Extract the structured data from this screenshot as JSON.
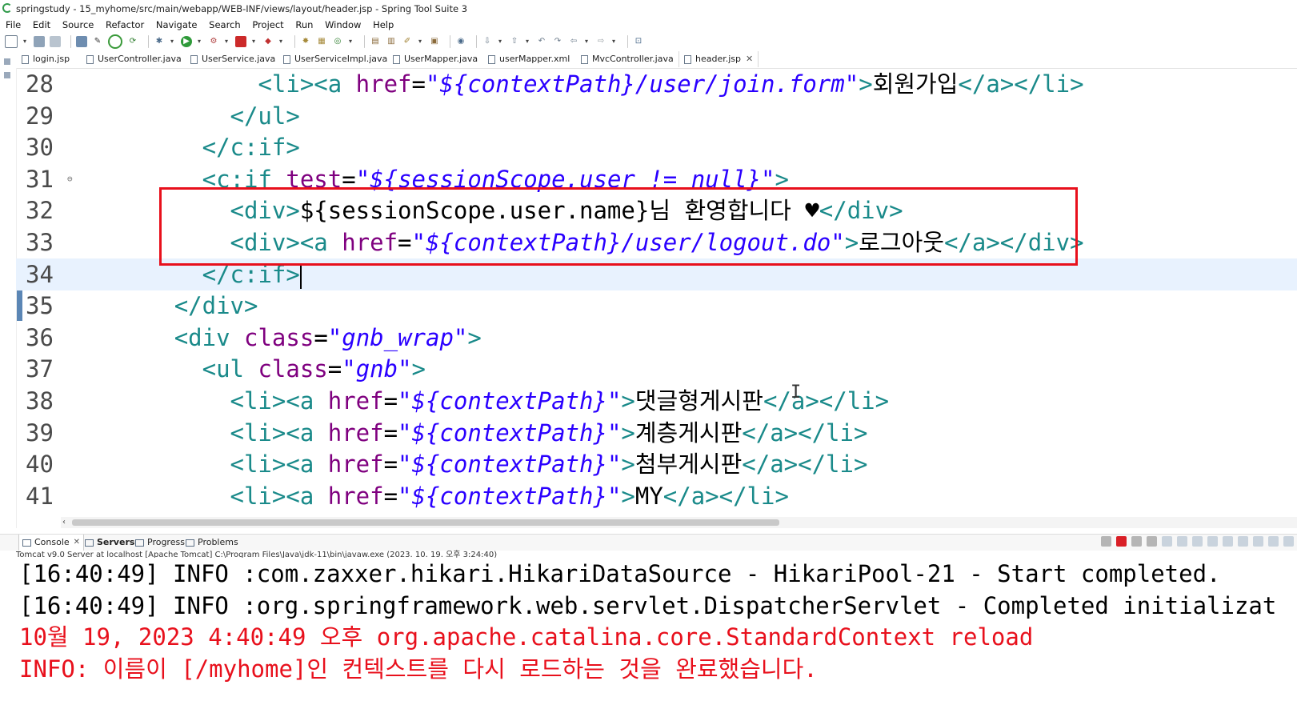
{
  "window": {
    "title": "springstudy - 15_myhome/src/main/webapp/WEB-INF/views/layout/header.jsp - Spring Tool Suite 3"
  },
  "menu": [
    "File",
    "Edit",
    "Source",
    "Refactor",
    "Navigate",
    "Search",
    "Project",
    "Run",
    "Window",
    "Help"
  ],
  "tabs": [
    {
      "label": "login.jsp"
    },
    {
      "label": "UserController.java"
    },
    {
      "label": "UserService.java"
    },
    {
      "label": "UserServiceImpl.java"
    },
    {
      "label": "UserMapper.java"
    },
    {
      "label": "userMapper.xml"
    },
    {
      "label": "MvcController.java"
    },
    {
      "label": "header.jsp",
      "active": true
    }
  ],
  "editor": {
    "current_line": "34",
    "lines": [
      {
        "n": "28",
        "indent": "      ",
        "tokens": [
          [
            "tag",
            "<li><a "
          ],
          [
            "attr",
            "href"
          ],
          [
            "txt",
            "="
          ],
          [
            "str",
            "\"${contextPath}/user/join.form\""
          ],
          [
            "tag",
            ">"
          ],
          [
            "txt",
            "회원가입"
          ],
          [
            "tag",
            "</a></li>"
          ]
        ]
      },
      {
        "n": "29",
        "indent": "     ",
        "tokens": [
          [
            "tag",
            "</ul>"
          ]
        ]
      },
      {
        "n": "30",
        "indent": "    ",
        "tokens": [
          [
            "tag",
            "</c:if>"
          ]
        ]
      },
      {
        "n": "31",
        "indent": "    ",
        "fold": "⊖",
        "tokens": [
          [
            "tag",
            "<c:if "
          ],
          [
            "attr",
            "test"
          ],
          [
            "txt",
            "="
          ],
          [
            "str",
            "\"${sessionScope.user != null}\""
          ],
          [
            "tag",
            ">"
          ]
        ]
      },
      {
        "n": "32",
        "indent": "     ",
        "tokens": [
          [
            "tag",
            "<div>"
          ],
          [
            "txt",
            "${sessionScope.user.name}님 환영합니다 ♥"
          ],
          [
            "tag",
            "</div>"
          ]
        ]
      },
      {
        "n": "33",
        "indent": "     ",
        "tokens": [
          [
            "tag",
            "<div><a "
          ],
          [
            "attr",
            "href"
          ],
          [
            "txt",
            "="
          ],
          [
            "str",
            "\"${contextPath}/user/logout.do\""
          ],
          [
            "tag",
            ">"
          ],
          [
            "txt",
            "로그아웃"
          ],
          [
            "tag",
            "</a></div>"
          ]
        ]
      },
      {
        "n": "34",
        "indent": "    ",
        "tokens": [
          [
            "tag",
            "</c:if>"
          ]
        ]
      },
      {
        "n": "35",
        "indent": "   ",
        "tokens": [
          [
            "tag",
            "</div>"
          ]
        ]
      },
      {
        "n": "36",
        "indent": "   ",
        "tokens": [
          [
            "tag",
            "<div "
          ],
          [
            "attr",
            "class"
          ],
          [
            "txt",
            "="
          ],
          [
            "str",
            "\"gnb_wrap\""
          ],
          [
            "tag",
            ">"
          ]
        ]
      },
      {
        "n": "37",
        "indent": "    ",
        "tokens": [
          [
            "tag",
            "<ul "
          ],
          [
            "attr",
            "class"
          ],
          [
            "txt",
            "="
          ],
          [
            "str",
            "\"gnb\""
          ],
          [
            "tag",
            ">"
          ]
        ]
      },
      {
        "n": "38",
        "indent": "     ",
        "tokens": [
          [
            "tag",
            "<li><a "
          ],
          [
            "attr",
            "href"
          ],
          [
            "txt",
            "="
          ],
          [
            "str",
            "\"${contextPath}\""
          ],
          [
            "tag",
            ">"
          ],
          [
            "txt",
            "댓글형게시판"
          ],
          [
            "tag",
            "</a></li>"
          ]
        ]
      },
      {
        "n": "39",
        "indent": "     ",
        "tokens": [
          [
            "tag",
            "<li><a "
          ],
          [
            "attr",
            "href"
          ],
          [
            "txt",
            "="
          ],
          [
            "str",
            "\"${contextPath}\""
          ],
          [
            "tag",
            ">"
          ],
          [
            "txt",
            "계층게시판"
          ],
          [
            "tag",
            "</a></li>"
          ]
        ]
      },
      {
        "n": "40",
        "indent": "     ",
        "tokens": [
          [
            "tag",
            "<li><a "
          ],
          [
            "attr",
            "href"
          ],
          [
            "txt",
            "="
          ],
          [
            "str",
            "\"${contextPath}\""
          ],
          [
            "tag",
            ">"
          ],
          [
            "txt",
            "첨부게시판"
          ],
          [
            "tag",
            "</a></li>"
          ]
        ]
      },
      {
        "n": "41",
        "indent": "     ",
        "tokens": [
          [
            "tag",
            "<li><a "
          ],
          [
            "attr",
            "href"
          ],
          [
            "txt",
            "="
          ],
          [
            "str",
            "\"${contextPath}\""
          ],
          [
            "tag",
            ">"
          ],
          [
            "txt",
            "MY"
          ],
          [
            "tag",
            "</a></li>"
          ]
        ]
      }
    ]
  },
  "console_tabs": [
    {
      "label": "Console",
      "active": true
    },
    {
      "label": "Servers"
    },
    {
      "label": "Progress"
    },
    {
      "label": "Problems"
    }
  ],
  "console": {
    "description": "Tomcat v9.0 Server at localhost [Apache Tomcat] C:\\Program Files\\Java\\jdk-11\\bin\\javaw.exe  (2023. 10. 19. 오후 3:24:40)",
    "lines": [
      {
        "text": "[16:40:49] INFO :com.zaxxer.hikari.HikariDataSource - HikariPool-21 - Start completed.",
        "error": false
      },
      {
        "text": "[16:40:49] INFO :org.springframework.web.servlet.DispatcherServlet - Completed initializat",
        "error": false
      },
      {
        "text": "10월 19, 2023 4:40:49 오후 org.apache.catalina.core.StandardContext reload",
        "error": true
      },
      {
        "text": "INFO: 이름이 [/myhome]인 컨텍스트를 다시 로드하는 것을 완료했습니다.",
        "error": true
      }
    ]
  },
  "colors": {
    "tag": "#1a8a8a",
    "attribute": "#7f007f",
    "string": "#2a00ff",
    "error": "#e8101c",
    "highlight_box": "#e8101c",
    "current_line": "#e8f2fe"
  }
}
